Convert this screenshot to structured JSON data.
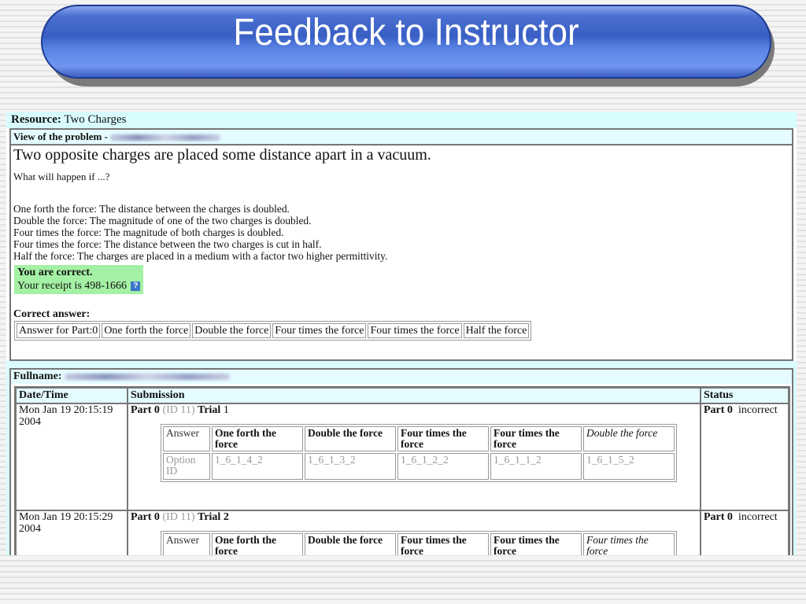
{
  "banner": {
    "title": "Feedback to Instructor"
  },
  "resource": {
    "label": "Resource:",
    "value": "Two Charges"
  },
  "problem_view": {
    "header_label": "View of the problem -",
    "title": "Two opposite charges are placed some distance apart in a vacuum.",
    "question": "What will happen if ...?",
    "options": [
      "One forth the force: The distance between the charges is doubled.",
      "Double the force: The magnitude of one of the two charges is doubled.",
      "Four times the force: The magnitude of both charges is doubled.",
      "Four times the force: The distance between the two charges is cut in half.",
      "Half the force: The charges are placed in a medium with a factor two higher permittivity."
    ],
    "result": {
      "status": "You are correct.",
      "receipt": "Your receipt is 498-1666",
      "help_icon": "?"
    },
    "correct_answer": {
      "label": "Correct answer:",
      "cells": [
        "Answer for Part:0",
        "One forth the force",
        "Double the force",
        "Four times the force",
        "Four times the force",
        "Half the force"
      ]
    }
  },
  "submissions": {
    "fullname_label": "Fullname:",
    "columns": [
      "Date/Time",
      "Submission",
      "Status"
    ],
    "rows": [
      {
        "datetime": "Mon Jan 19 20:15:19 2004",
        "part": "Part 0",
        "id": "(ID 11)",
        "trial_label": "Trial",
        "trial_num": "1",
        "answer_label": "Answer",
        "answers": [
          "One forth the force",
          "Double the force",
          "Four times the force",
          "Four times the force",
          "Double the force"
        ],
        "option_label": "Option ID",
        "option_ids": [
          "1_6_1_4_2",
          "1_6_1_3_2",
          "1_6_1_2_2",
          "1_6_1_1_2",
          "1_6_1_5_2"
        ],
        "status_part": "Part 0",
        "status": "incorrect"
      },
      {
        "datetime": "Mon Jan 19 20:15:29 2004",
        "part": "Part 0",
        "id": "(ID 11)",
        "trial_label": "Trial",
        "trial_num": "2",
        "answer_label": "Answer",
        "answers": [
          "One forth the force",
          "Double the force",
          "Four times the force",
          "Four times the force",
          "Four times the force"
        ],
        "status_part": "Part 0",
        "status": "incorrect"
      }
    ]
  }
}
